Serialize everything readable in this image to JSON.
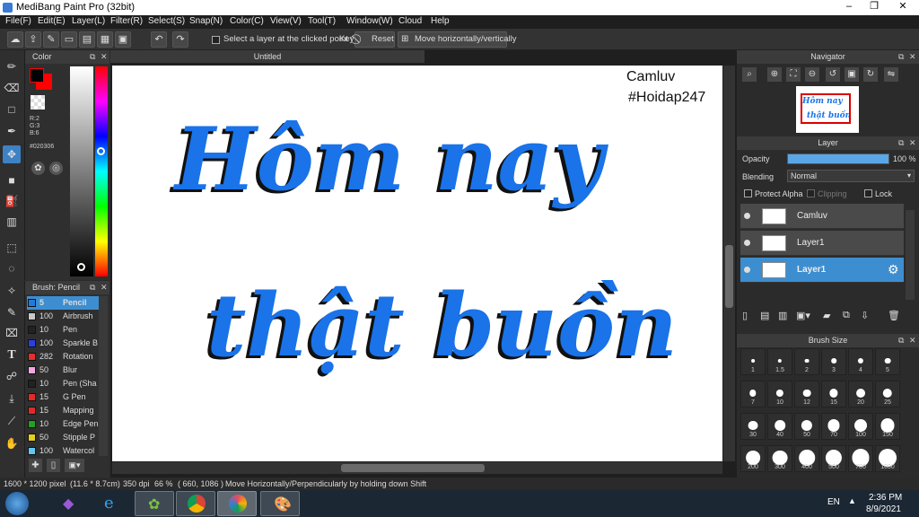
{
  "window": {
    "title": "MediBang Paint Pro (32bit)",
    "controls": [
      "–",
      "❐",
      "✕"
    ]
  },
  "menu": [
    "File(F)",
    "Edit(E)",
    "Layer(L)",
    "Filter(R)",
    "Select(S)",
    "Snap(N)",
    "Color(C)",
    "View(V)",
    "Tool(T)",
    "Window(W)",
    "Cloud",
    "Help"
  ],
  "toolbar": {
    "select_layer_label": "Select a layer at the clicked point",
    "key_label": "Key",
    "reset_label": "Reset",
    "move_label": "Move horizontally/vertically"
  },
  "color_panel": {
    "title": "Color",
    "rgb": {
      "r": "R:2",
      "g": "G:3",
      "b": "B:6"
    },
    "hex": "#020306",
    "primary_color": "#020306",
    "secondary_color": "#ff0000"
  },
  "brush_panel": {
    "title": "Brush: Pencil",
    "items": [
      {
        "size": "5",
        "name": "Pencil",
        "color": "#1e7be0",
        "selected": true
      },
      {
        "size": "100",
        "name": "Airbrush",
        "color": "#c8c8c8"
      },
      {
        "size": "10",
        "name": "Pen",
        "color": "#222222"
      },
      {
        "size": "100",
        "name": "Sparkle B",
        "color": "#2a3fe0"
      },
      {
        "size": "282",
        "name": "Rotation",
        "color": "#e03030"
      },
      {
        "size": "50",
        "name": "Blur",
        "color": "#f4a6e0"
      },
      {
        "size": "10",
        "name": "Pen (Sha",
        "color": "#222222"
      },
      {
        "size": "15",
        "name": "G Pen",
        "color": "#e02a2a"
      },
      {
        "size": "15",
        "name": "Mapping",
        "color": "#e02a2a"
      },
      {
        "size": "10",
        "name": "Edge Pen",
        "color": "#22a022"
      },
      {
        "size": "50",
        "name": "Stipple P",
        "color": "#e0d020"
      },
      {
        "size": "100",
        "name": "Watercol",
        "color": "#60c8f0"
      }
    ]
  },
  "document": {
    "tab_title": "Untitled",
    "text_camluv": "Camluv",
    "text_hashtag": "#Hoidap247",
    "line1": "Hôm nay",
    "line2": "thật buồn",
    "ink_color": "#1a73e8"
  },
  "navigator": {
    "title": "Navigator",
    "thumb_line1": "Hôm nay",
    "thumb_line2": "thật buồn"
  },
  "layer_panel": {
    "title": "Layer",
    "opacity_label": "Opacity",
    "opacity_value": "100 %",
    "opacity_fraction": 1.0,
    "blending_label": "Blending",
    "blending_value": "Normal",
    "protect_alpha_label": "Protect Alpha",
    "clipping_label": "Clipping",
    "lock_label": "Lock",
    "layers": [
      {
        "name": "Camluv",
        "selected": false
      },
      {
        "name": "Layer1",
        "selected": false
      },
      {
        "name": "Layer1",
        "selected": true
      }
    ]
  },
  "brush_size_panel": {
    "title": "Brush Size",
    "sizes": [
      "1",
      "1.5",
      "2",
      "3",
      "4",
      "5",
      "7",
      "10",
      "12",
      "15",
      "20",
      "25",
      "30",
      "40",
      "50",
      "70",
      "100",
      "150",
      "200",
      "300",
      "400",
      "500",
      "700",
      "1000"
    ]
  },
  "status": {
    "dimensions": "1600 * 1200 pixel",
    "physical": "(11.6 * 8.7cm)",
    "dpi": "350 dpi",
    "zoom": "66 %",
    "coords": "( 660, 1086 )",
    "hint": "Move Horizontally/Perpendicularly by holding down Shift"
  },
  "taskbar": {
    "lang": "EN",
    "time": "2:36 PM",
    "date": "8/9/2021"
  }
}
